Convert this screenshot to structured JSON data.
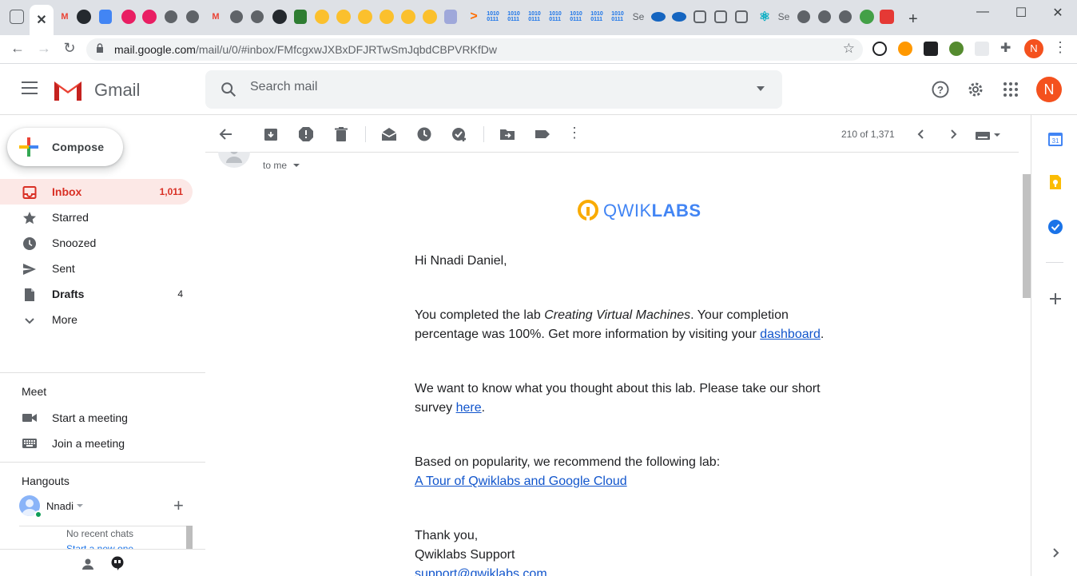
{
  "browser": {
    "url_host": "mail.google.com",
    "url_path": "/mail/u/0/#inbox/FMfcgxwJXBxDFJRTwSmJqbdCBPVRKfDw",
    "tabs_binary_label": "1010\n0111",
    "tab_se_label": "Se",
    "profile_initial": "N"
  },
  "gmail": {
    "logo_text": "Gmail",
    "search_placeholder": "Search mail",
    "avatar_initial": "N"
  },
  "sidebar": {
    "compose_label": "Compose",
    "items": [
      {
        "label": "Inbox",
        "count": "1,011",
        "icon": "inbox-icon"
      },
      {
        "label": "Starred",
        "count": "",
        "icon": "star-icon"
      },
      {
        "label": "Snoozed",
        "count": "",
        "icon": "clock-icon"
      },
      {
        "label": "Sent",
        "count": "",
        "icon": "send-icon"
      },
      {
        "label": "Drafts",
        "count": "4",
        "icon": "draft-icon"
      },
      {
        "label": "More",
        "count": "",
        "icon": "chevron-down-icon"
      }
    ],
    "meet": {
      "title": "Meet",
      "start": "Start a meeting",
      "join": "Join a meeting"
    },
    "hangouts": {
      "title": "Hangouts",
      "user": "Nnadi",
      "no_recent": "No recent chats",
      "start_new": "Start a new one"
    }
  },
  "toolbar": {
    "pager": "210 of 1,371"
  },
  "email": {
    "to_me": "to me",
    "brand_light": "QWIK",
    "brand_bold": "LABS",
    "greeting": "Hi Nnadi Daniel,",
    "p1_a": "You completed the lab ",
    "p1_lab": "Creating Virtual Machines",
    "p1_b": ". Your completion percentage was 100%. Get more information by visiting your ",
    "p1_link": "dashboard",
    "p1_c": ".",
    "p2_a": "We want to know what you thought about this lab. Please take our short survey ",
    "p2_link": "here",
    "p2_c": ".",
    "p3_a": "Based on popularity, we recommend the following lab:",
    "p3_link": "A Tour of Qwiklabs and Google Cloud",
    "signoff1": "Thank you,",
    "signoff2": "Qwiklabs Support",
    "support_email": "support@qwiklabs.com"
  },
  "colors": {
    "accent_red": "#d93025",
    "link_blue": "#1155cc",
    "qwiklabs_yellow": "#f9ab00",
    "qwiklabs_blue": "#4285f4"
  }
}
